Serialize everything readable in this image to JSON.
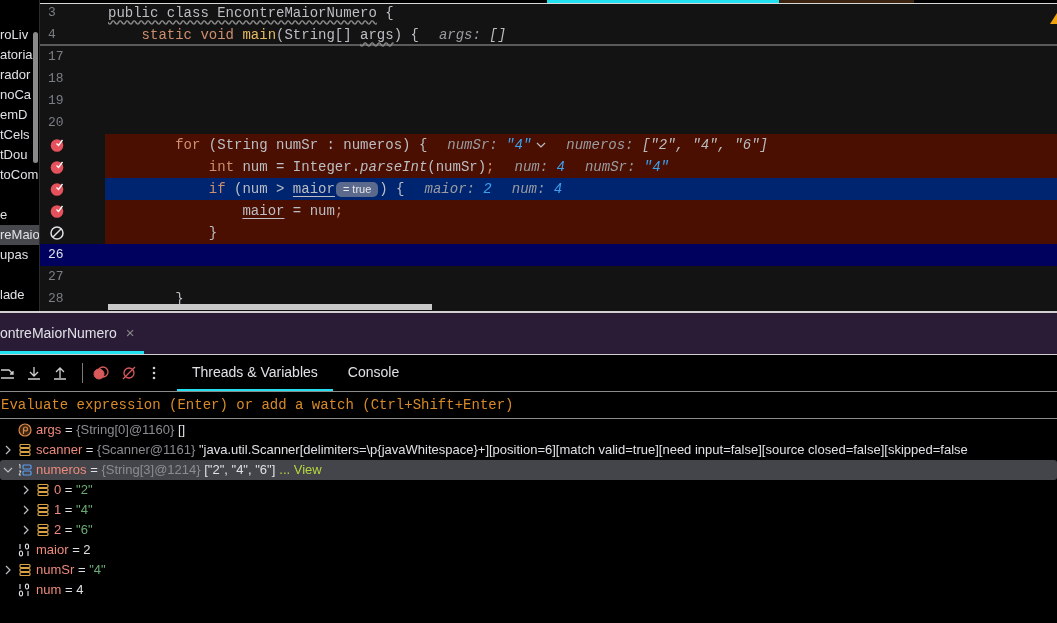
{
  "sidebar": {
    "groups": [
      [
        {
          "label": "roLiv",
          "selected": false
        },
        {
          "label": "atoria",
          "selected": false
        },
        {
          "label": "rador",
          "selected": false
        },
        {
          "label": "noCa",
          "selected": false
        },
        {
          "label": "emD",
          "selected": false
        },
        {
          "label": "tCels",
          "selected": false
        },
        {
          "label": "tDou",
          "selected": false
        },
        {
          "label": "toCom",
          "selected": false
        }
      ],
      [
        {
          "label": "e",
          "selected": false
        },
        {
          "label": "reMaio",
          "selected": true
        },
        {
          "label": "upas",
          "selected": false
        }
      ],
      [
        {
          "label": "lade",
          "selected": false
        }
      ]
    ]
  },
  "editor": {
    "header_lines": [
      {
        "number": "3",
        "tokens": [
          {
            "text": "public class EncontreMaiorNumero",
            "kind": "wavy"
          },
          {
            "text": " {",
            "kind": "plain"
          }
        ]
      },
      {
        "number": "4",
        "tokens": [
          {
            "text": "    static void",
            "kind": "kw"
          },
          {
            "text": " main",
            "kind": "decl"
          },
          {
            "text": "(String[] ",
            "kind": "plain"
          },
          {
            "text": "args",
            "kind": "wavy"
          },
          {
            "text": ") {",
            "kind": "plain"
          }
        ],
        "hints": [
          {
            "name": "args:",
            "value": "[]",
            "kind": "plain"
          }
        ]
      }
    ],
    "lines": [
      {
        "number": "17"
      },
      {
        "number": "18"
      },
      {
        "number": "19"
      },
      {
        "number": "20"
      },
      {
        "breakpoint": true,
        "disabled": false,
        "current": false,
        "tokens": [
          {
            "text": "        for",
            "kind": "kw"
          },
          {
            "text": " (String numSr : numeros) {",
            "kind": "plain"
          }
        ],
        "hints": [
          {
            "name": "numSr:",
            "value": "\"4\"",
            "kind": "literal",
            "expandable": true
          },
          {
            "name": "numeros:",
            "value": "[\"2\", \"4\", \"6\"]",
            "kind": "plain"
          }
        ]
      },
      {
        "breakpoint": true,
        "disabled": false,
        "current": false,
        "tokens": [
          {
            "text": "            int",
            "kind": "kw"
          },
          {
            "text": " num = Integer.",
            "kind": "plain"
          },
          {
            "text": "parseInt",
            "kind": "italic"
          },
          {
            "text": "(numSr)",
            "kind": "plain"
          },
          {
            "text": ";",
            "kind": "punct"
          }
        ],
        "hints": [
          {
            "name": "num:",
            "value": "4",
            "kind": "literal"
          },
          {
            "name": "numSr:",
            "value": "\"4\"",
            "kind": "literal"
          }
        ]
      },
      {
        "breakpoint": true,
        "disabled": false,
        "current": true,
        "tokens": [
          {
            "text": "            if",
            "kind": "kw"
          },
          {
            "text": " (num > ",
            "kind": "plain"
          },
          {
            "text": "maior",
            "kind": "underline"
          },
          {
            "text": "= true",
            "kind": "inline-value"
          },
          {
            "text": ") {",
            "kind": "plain"
          }
        ],
        "hints": [
          {
            "name": "maior:",
            "value": "2",
            "kind": "literal"
          },
          {
            "name": "num:",
            "value": "4",
            "kind": "literal"
          }
        ]
      },
      {
        "breakpoint": true,
        "disabled": false,
        "current": false,
        "tokens": [
          {
            "text": "                maior",
            "kind": "underline"
          },
          {
            "text": " = num",
            "kind": "plain"
          },
          {
            "text": ";",
            "kind": "punct"
          }
        ]
      },
      {
        "breakpoint": true,
        "disabled": true,
        "current": false,
        "tokens": [
          {
            "text": "            }",
            "kind": "plain"
          }
        ]
      },
      {
        "number": "26",
        "caret": true
      },
      {
        "number": "27"
      },
      {
        "number": "28",
        "tokens": [
          {
            "text": "        }",
            "kind": "plain"
          }
        ]
      }
    ]
  },
  "debug": {
    "session_tab": {
      "label": "ontreMaiorNumero",
      "selected": true,
      "close": "×"
    },
    "tabs": [
      {
        "label": "Threads & Variables",
        "selected": true
      },
      {
        "label": "Console",
        "selected": false
      }
    ],
    "evaluate": {
      "placeholder": "Evaluate expression (Enter) or add a watch (Ctrl+Shift+Enter)"
    },
    "variables": [
      {
        "kind": "param",
        "name": "args",
        "operator": "=",
        "type_info": "{String[0]@1160}",
        "value": "[]",
        "string": false,
        "selected": false
      },
      {
        "kind": "object",
        "name": "scanner",
        "operator": "=",
        "type_info": "{Scanner@1161}",
        "value": "\"java.util.Scanner[delimiters=\\p{javaWhitespace}+][position=6][match valid=true][need input=false][source closed=false][skipped=false",
        "string": false,
        "expandable": true,
        "expanded": false,
        "selected": false
      },
      {
        "kind": "array",
        "name": "numeros",
        "operator": "=",
        "type_info": "{String[3]@1214}",
        "value": "[\"2\", \"4\", \"6\"]",
        "string": false,
        "link": "... View",
        "expandable": true,
        "expanded": true,
        "selected": true,
        "children": [
          {
            "kind": "object",
            "name": "0",
            "operator": "=",
            "value": "\"2\"",
            "string": true,
            "expandable": true,
            "expanded": false,
            "selected": false
          },
          {
            "kind": "object",
            "name": "1",
            "operator": "=",
            "value": "\"4\"",
            "string": true,
            "expandable": true,
            "expanded": false,
            "selected": false
          },
          {
            "kind": "object",
            "name": "2",
            "operator": "=",
            "value": "\"6\"",
            "string": true,
            "expandable": true,
            "expanded": false,
            "selected": false
          }
        ]
      },
      {
        "kind": "primitive",
        "name": "maior",
        "operator": "=",
        "value": "2",
        "string": false,
        "selected": false
      },
      {
        "kind": "object",
        "name": "numSr",
        "operator": "=",
        "value": "\"4\"",
        "string": true,
        "expandable": true,
        "expanded": false,
        "selected": false
      },
      {
        "kind": "primitive",
        "name": "num",
        "operator": "=",
        "value": "4",
        "string": false,
        "selected": false
      }
    ]
  }
}
